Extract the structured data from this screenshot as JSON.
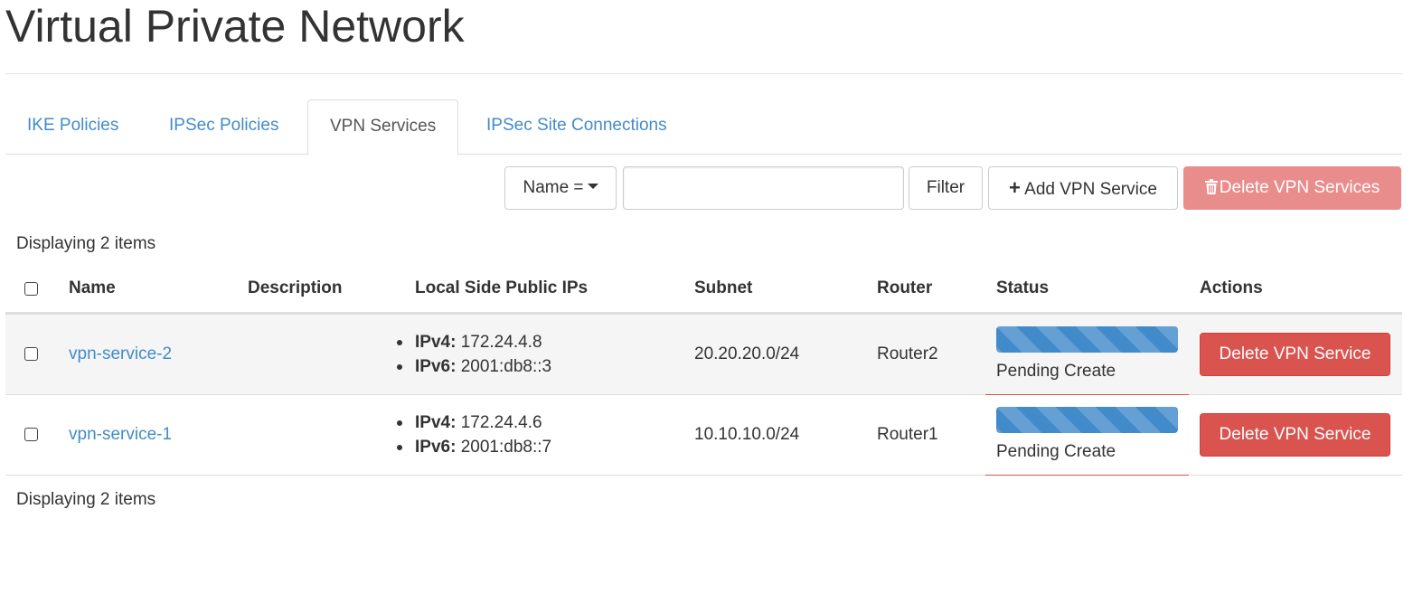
{
  "page": {
    "title": "Virtual Private Network"
  },
  "tabs": [
    {
      "label": "IKE Policies",
      "active": false
    },
    {
      "label": "IPSec Policies",
      "active": false
    },
    {
      "label": "VPN Services",
      "active": true
    },
    {
      "label": "IPSec Site Connections",
      "active": false
    }
  ],
  "toolbar": {
    "filter_field_label": "Name =",
    "search_value": "",
    "filter_label": "Filter",
    "add_label": "Add VPN Service",
    "delete_label": "Delete VPN Services",
    "plus_icon": "+",
    "trash_icon": "🗑"
  },
  "table": {
    "count_text": "Displaying 2 items",
    "columns": [
      "Name",
      "Description",
      "Local Side Public IPs",
      "Subnet",
      "Router",
      "Status",
      "Actions"
    ],
    "rows": [
      {
        "name": "vpn-service-2",
        "description": "",
        "ipv4_label": "IPv4:",
        "ipv4": "172.24.4.8",
        "ipv6_label": "IPv6:",
        "ipv6": "2001:db8::3",
        "subnet": "20.20.20.0/24",
        "router": "Router2",
        "status": "Pending Create",
        "progress": 1.0,
        "action_label": "Delete VPN Service"
      },
      {
        "name": "vpn-service-1",
        "description": "",
        "ipv4_label": "IPv4:",
        "ipv4": "172.24.4.6",
        "ipv6_label": "IPv6:",
        "ipv6": "2001:db8::7",
        "subnet": "10.10.10.0/24",
        "router": "Router1",
        "status": "Pending Create",
        "progress": 1.0,
        "action_label": "Delete VPN Service"
      }
    ]
  },
  "colors": {
    "link": "#428bca",
    "danger": "#d9534f",
    "progress": "#428bca"
  }
}
